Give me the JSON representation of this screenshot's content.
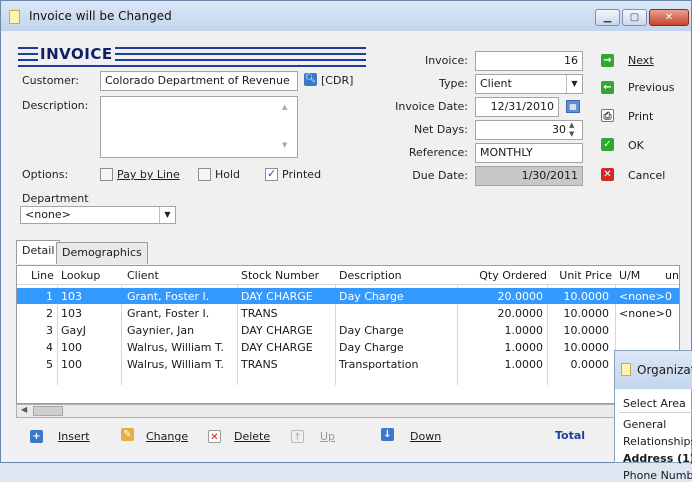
{
  "window": {
    "title": "Invoice will be Changed",
    "minimize": "▁",
    "maximize": "▢",
    "close": "✕"
  },
  "banner": {
    "text": "INVOICE"
  },
  "customer": {
    "label": "Customer:",
    "value": "Colorado Department of Revenue",
    "code": "[CDR]"
  },
  "description": {
    "label": "Description:",
    "value": ""
  },
  "options": {
    "label": "Options:",
    "pay_by_line": "Pay by Line",
    "pay_by_line_checked": false,
    "hold": "Hold",
    "hold_checked": false,
    "printed": "Printed",
    "printed_checked": true
  },
  "department": {
    "label": "Department",
    "value": "<none>"
  },
  "invoice": {
    "label": "Invoice:",
    "value": "16"
  },
  "type": {
    "label": "Type:",
    "value": "Client"
  },
  "invoice_date": {
    "label": "Invoice Date:",
    "value": "12/31/2010"
  },
  "net_days": {
    "label": "Net Days:",
    "value": "30"
  },
  "reference": {
    "label": "Reference:",
    "value": "MONTHLY"
  },
  "due_date": {
    "label": "Due Date:",
    "value": "1/30/2011"
  },
  "actions": {
    "next": "Next",
    "previous": "Previous",
    "print": "Print",
    "ok": "OK",
    "cancel": "Cancel"
  },
  "tabs": {
    "detail": "Detail",
    "demographics": "Demographics"
  },
  "grid": {
    "columns": {
      "line": "Line",
      "lookup": "Lookup",
      "client": "Client",
      "stock": "Stock Number",
      "desc": "Description",
      "qty": "Qty Ordered",
      "price": "Unit Price",
      "um": "U/M",
      "amt": "unt"
    },
    "rows": [
      {
        "line": "1",
        "lookup": "103",
        "client": "Grant, Foster I.",
        "stock": "DAY CHARGE",
        "desc": "Day Charge",
        "qty": "20.0000",
        "price": "10.0000",
        "um": "<none>",
        "amt": "0"
      },
      {
        "line": "2",
        "lookup": "103",
        "client": "Grant, Foster I.",
        "stock": "TRANS",
        "desc": "",
        "qty": "20.0000",
        "price": "10.0000",
        "um": "<none>",
        "amt": "0"
      },
      {
        "line": "3",
        "lookup": "GayJ",
        "client": "Gaynier, Jan",
        "stock": "DAY CHARGE",
        "desc": "Day Charge",
        "qty": "1.0000",
        "price": "10.0000",
        "um": "",
        "amt": ""
      },
      {
        "line": "4",
        "lookup": "100",
        "client": "Walrus, William T.",
        "stock": "DAY CHARGE",
        "desc": "Day Charge",
        "qty": "1.0000",
        "price": "10.0000",
        "um": "",
        "amt": ""
      },
      {
        "line": "5",
        "lookup": "100",
        "client": "Walrus, William T.",
        "stock": "TRANS",
        "desc": "Transportation",
        "qty": "1.0000",
        "price": "0.0000",
        "um": "",
        "amt": ""
      }
    ]
  },
  "bottom": {
    "insert": "Insert",
    "change": "Change",
    "delete": "Delete",
    "up": "Up",
    "down": "Down",
    "total": "Total"
  },
  "org_popup": {
    "title": "Organizat",
    "select_area": "Select Area",
    "items": [
      "General",
      "Relationships",
      "Address (1)",
      "Phone Numb"
    ]
  }
}
